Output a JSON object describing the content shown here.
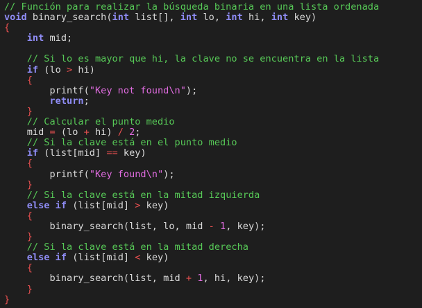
{
  "editor": {
    "colors": {
      "background": "#1e1e1e",
      "comment": "#57c957",
      "keyword": "#8f8cf5",
      "operator": "#e85050",
      "string": "#e06ce0",
      "plain": "#dadada"
    },
    "lines": [
      [
        {
          "t": "comment",
          "v": "// Función para realizar la búsqueda binaria en una lista ordenada"
        }
      ],
      [
        {
          "t": "keyword",
          "v": "void"
        },
        {
          "t": "plain",
          "v": " binary_search("
        },
        {
          "t": "keyword",
          "v": "int"
        },
        {
          "t": "plain",
          "v": " list[], "
        },
        {
          "t": "keyword",
          "v": "int"
        },
        {
          "t": "plain",
          "v": " lo, "
        },
        {
          "t": "keyword",
          "v": "int"
        },
        {
          "t": "plain",
          "v": " hi, "
        },
        {
          "t": "keyword",
          "v": "int"
        },
        {
          "t": "plain",
          "v": " key)"
        }
      ],
      [
        {
          "t": "brace",
          "v": "{"
        }
      ],
      [
        {
          "t": "plain",
          "v": "    "
        },
        {
          "t": "keyword",
          "v": "int"
        },
        {
          "t": "plain",
          "v": " mid;"
        }
      ],
      [
        {
          "t": "plain",
          "v": ""
        }
      ],
      [
        {
          "t": "plain",
          "v": "    "
        },
        {
          "t": "comment",
          "v": "// Si lo es mayor que hi, la clave no se encuentra en la lista"
        }
      ],
      [
        {
          "t": "plain",
          "v": "    "
        },
        {
          "t": "keyword",
          "v": "if"
        },
        {
          "t": "plain",
          "v": " (lo "
        },
        {
          "t": "op",
          "v": ">"
        },
        {
          "t": "plain",
          "v": " hi)"
        }
      ],
      [
        {
          "t": "plain",
          "v": "    "
        },
        {
          "t": "brace",
          "v": "{"
        }
      ],
      [
        {
          "t": "plain",
          "v": "        printf("
        },
        {
          "t": "string",
          "v": "\"Key not found\\n\""
        },
        {
          "t": "plain",
          "v": ");"
        }
      ],
      [
        {
          "t": "plain",
          "v": "        "
        },
        {
          "t": "keyword",
          "v": "return"
        },
        {
          "t": "plain",
          "v": ";"
        }
      ],
      [
        {
          "t": "plain",
          "v": "    "
        },
        {
          "t": "brace",
          "v": "}"
        }
      ],
      [
        {
          "t": "plain",
          "v": "    "
        },
        {
          "t": "comment",
          "v": "// Calcular el punto medio"
        }
      ],
      [
        {
          "t": "plain",
          "v": "    mid "
        },
        {
          "t": "op",
          "v": "="
        },
        {
          "t": "plain",
          "v": " (lo "
        },
        {
          "t": "op",
          "v": "+"
        },
        {
          "t": "plain",
          "v": " hi) "
        },
        {
          "t": "op",
          "v": "/"
        },
        {
          "t": "plain",
          "v": " "
        },
        {
          "t": "number",
          "v": "2"
        },
        {
          "t": "plain",
          "v": ";"
        }
      ],
      [
        {
          "t": "plain",
          "v": "    "
        },
        {
          "t": "comment",
          "v": "// Si la clave está en el punto medio"
        }
      ],
      [
        {
          "t": "plain",
          "v": "    "
        },
        {
          "t": "keyword",
          "v": "if"
        },
        {
          "t": "plain",
          "v": " (list[mid] "
        },
        {
          "t": "op",
          "v": "=="
        },
        {
          "t": "plain",
          "v": " key)"
        }
      ],
      [
        {
          "t": "plain",
          "v": "    "
        },
        {
          "t": "brace",
          "v": "{"
        }
      ],
      [
        {
          "t": "plain",
          "v": "        printf("
        },
        {
          "t": "string",
          "v": "\"Key found\\n\""
        },
        {
          "t": "plain",
          "v": ");"
        }
      ],
      [
        {
          "t": "plain",
          "v": "    "
        },
        {
          "t": "brace",
          "v": "}"
        }
      ],
      [
        {
          "t": "plain",
          "v": "    "
        },
        {
          "t": "comment",
          "v": "// Si la clave está en la mitad izquierda"
        }
      ],
      [
        {
          "t": "plain",
          "v": "    "
        },
        {
          "t": "keyword",
          "v": "else if"
        },
        {
          "t": "plain",
          "v": " (list[mid] "
        },
        {
          "t": "op",
          "v": ">"
        },
        {
          "t": "plain",
          "v": " key)"
        }
      ],
      [
        {
          "t": "plain",
          "v": "    "
        },
        {
          "t": "brace",
          "v": "{"
        }
      ],
      [
        {
          "t": "plain",
          "v": "        binary_search(list, lo, mid "
        },
        {
          "t": "op",
          "v": "-"
        },
        {
          "t": "plain",
          "v": " "
        },
        {
          "t": "number",
          "v": "1"
        },
        {
          "t": "plain",
          "v": ", key);"
        }
      ],
      [
        {
          "t": "plain",
          "v": "    "
        },
        {
          "t": "brace",
          "v": "}"
        }
      ],
      [
        {
          "t": "plain",
          "v": "    "
        },
        {
          "t": "comment",
          "v": "// Si la clave está en la mitad derecha"
        }
      ],
      [
        {
          "t": "plain",
          "v": "    "
        },
        {
          "t": "keyword",
          "v": "else if"
        },
        {
          "t": "plain",
          "v": " (list[mid] "
        },
        {
          "t": "op",
          "v": "<"
        },
        {
          "t": "plain",
          "v": " key)"
        }
      ],
      [
        {
          "t": "plain",
          "v": "    "
        },
        {
          "t": "brace",
          "v": "{"
        }
      ],
      [
        {
          "t": "plain",
          "v": "        binary_search(list, mid "
        },
        {
          "t": "op",
          "v": "+"
        },
        {
          "t": "plain",
          "v": " "
        },
        {
          "t": "number",
          "v": "1"
        },
        {
          "t": "plain",
          "v": ", hi, key);"
        }
      ],
      [
        {
          "t": "plain",
          "v": "    "
        },
        {
          "t": "brace",
          "v": "}"
        }
      ],
      [
        {
          "t": "brace",
          "v": "}"
        }
      ]
    ]
  }
}
